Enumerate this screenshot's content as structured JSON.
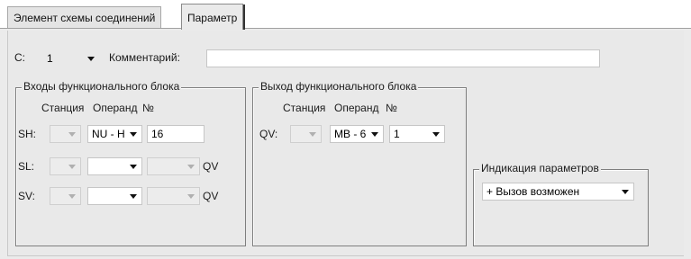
{
  "tabs": [
    {
      "label": "Элемент схемы соединений"
    },
    {
      "label": "Параметр"
    }
  ],
  "row1": {
    "c_label": "C:",
    "c_value": "1",
    "comment_label": "Комментарий:",
    "comment_value": ""
  },
  "inputs_group": {
    "title": "Входы функционального блока",
    "col_station": "Станция",
    "col_operand": "Операнд",
    "col_no": "№",
    "rows": [
      {
        "label": "SH:",
        "station": "",
        "operand": "NU - H",
        "number": "16",
        "suffix": ""
      },
      {
        "label": "SL:",
        "station": "",
        "operand": "",
        "number": "",
        "suffix": "QV"
      },
      {
        "label": "SV:",
        "station": "",
        "operand": "",
        "number": "",
        "suffix": "QV"
      }
    ]
  },
  "output_group": {
    "title": "Выход функционального блока",
    "col_station": "Станция",
    "col_operand": "Операнд",
    "col_no": "№",
    "row": {
      "label": "QV:",
      "station": "",
      "operand": "MB - 6",
      "number": "1"
    }
  },
  "indication_group": {
    "title": "Индикация параметров",
    "value": "+ Вызов возможен"
  }
}
